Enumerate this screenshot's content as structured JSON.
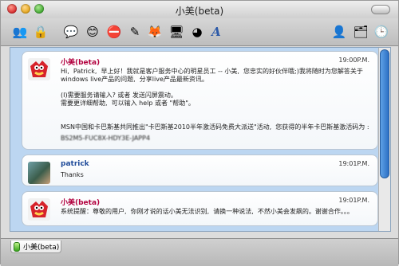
{
  "window": {
    "title": "小美(beta)"
  },
  "toolbar": {
    "icons": [
      "people-icon",
      "lock-icon",
      "chat-bubble-icon",
      "smiley-icon",
      "no-sign-icon",
      "pen-icon",
      "firefox-icon",
      "media-icon",
      "color-wheel-icon",
      "text-a-icon",
      "user-status-icon",
      "card-icon",
      "clock-icon"
    ]
  },
  "messages": [
    {
      "sender": "小美(beta)",
      "time": "19:00P.M.",
      "text": "Hi,  Patrick,  早上好！我就是客户服务中心的明星员工 -- 小美,  您忠实的好伙伴哦;)我将随时为您解答关于windows live产品的问题,  分享live产品最新资讯。\n\n(I)需要服务请输入? 或者 发送闪屏震动。\n需要更详细帮助,  可以输入 help 或者 \"帮助\"。\n\n\nMSN中国和卡巴斯基共同推出\"卡巴斯基2010半年激活码免费大派送\"活动,  您获得的半年卡巴斯基激活码为 :",
      "blurred_line": "BS2M5-FUC8X-HDY3E-JAPP4"
    },
    {
      "sender": "patrick",
      "time": "19:01P.M.",
      "text": "Thanks"
    },
    {
      "sender": "小美(beta)",
      "time": "19:01P.M.",
      "text": "系统提醒：尊敬的用户,  你刚才说的话小美无法识别,  请换一种说法,  不然小美会发飙的。谢谢合作。。。"
    }
  ],
  "footer": {
    "tab_label": "小美(beta)"
  }
}
